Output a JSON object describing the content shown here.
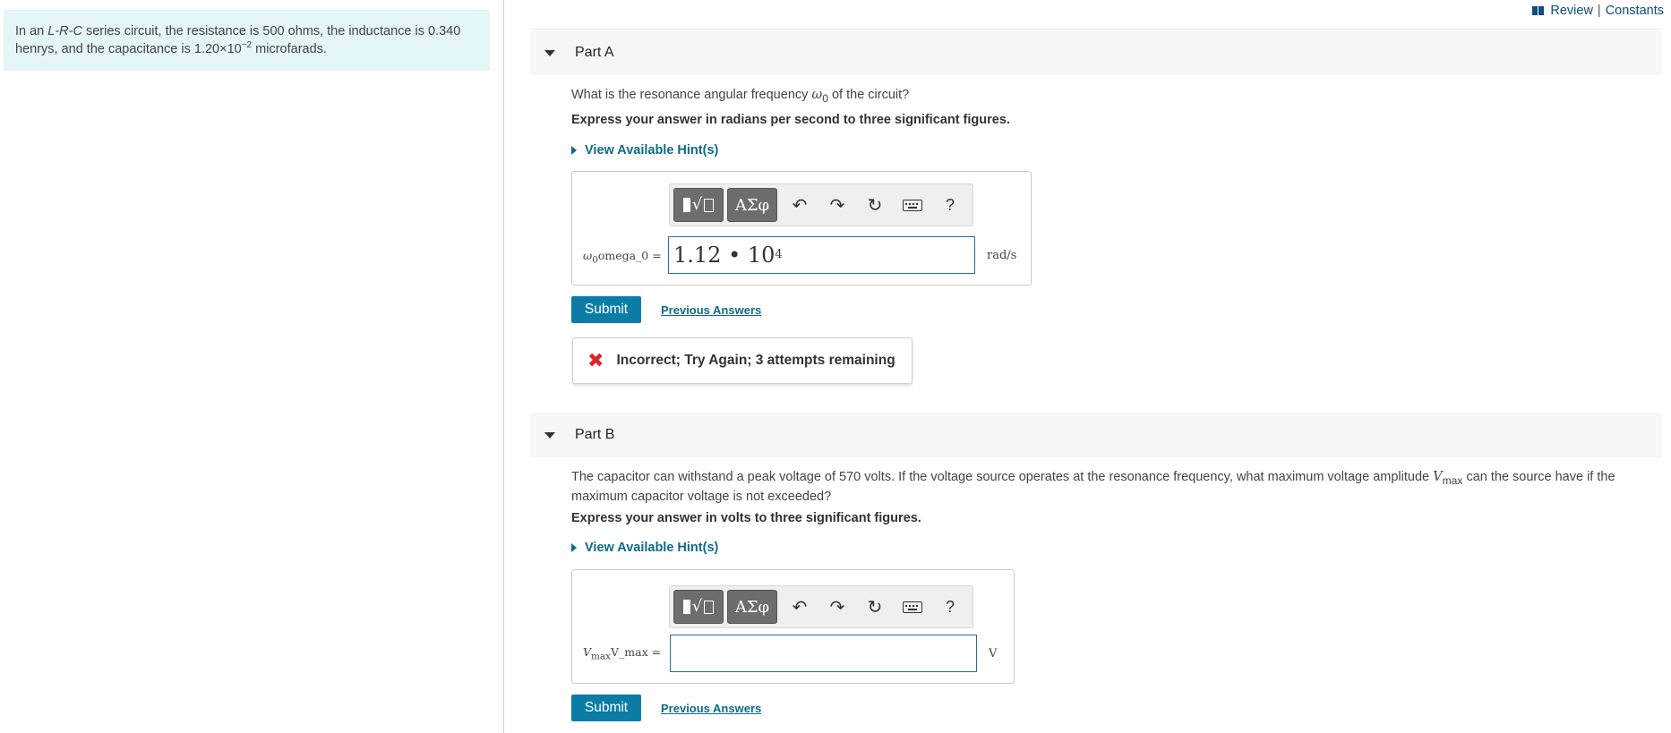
{
  "header": {
    "review_label": "Review",
    "separator": "|",
    "constants_label": "Constants"
  },
  "intro": {
    "t1": "In an ",
    "t2": "L-R-C",
    "t3": " series circuit, the resistance is 500 ohms, the inductance is 0.340 henrys, and the capacitance is 1.20×10",
    "t4": "−2",
    "t5": " microfarads."
  },
  "toolbar": {
    "greek_label": "ΑΣφ",
    "undo_glyph": "↶",
    "redo_glyph": "↷",
    "reset_glyph": "↻",
    "help_label": "?"
  },
  "partA": {
    "title": "Part A",
    "q1": "What is the resonance angular frequency ",
    "q_sym": "ω",
    "q_sub": "0",
    "q2": " of the circuit?",
    "instruction": "Express your answer in radians per second to three significant figures.",
    "hint_label": "View Available Hint(s)",
    "var_sym": "ω",
    "var_sub": "0",
    "var_text": "omega_0 =",
    "answer_mantissa": "1.12 • 10",
    "answer_exp": "4",
    "unit": "rad/s",
    "submit_label": "Submit",
    "previous_label": "Previous Answers",
    "feedback": "Incorrect; Try Again; 3 attempts remaining"
  },
  "partB": {
    "title": "Part B",
    "q1": "The capacitor can withstand a peak voltage of 570 volts. If the voltage source operates at the resonance frequency, what maximum voltage amplitude ",
    "q_sym": "V",
    "q_sub": "max",
    "q2": " can the source have if the maximum capacitor voltage is not exceeded?",
    "instruction": "Express your answer in volts to three significant figures.",
    "hint_label": "View Available Hint(s)",
    "var_sym": "V",
    "var_sub": "max",
    "var_text": "V_max =",
    "answer_value": "",
    "unit": "V",
    "submit_label": "Submit",
    "previous_label": "Previous Answers"
  },
  "colors": {
    "accent": "#0b7da5",
    "link": "#0f6a8a",
    "intro_bg": "#e4f6f7",
    "error": "#d9262c"
  }
}
